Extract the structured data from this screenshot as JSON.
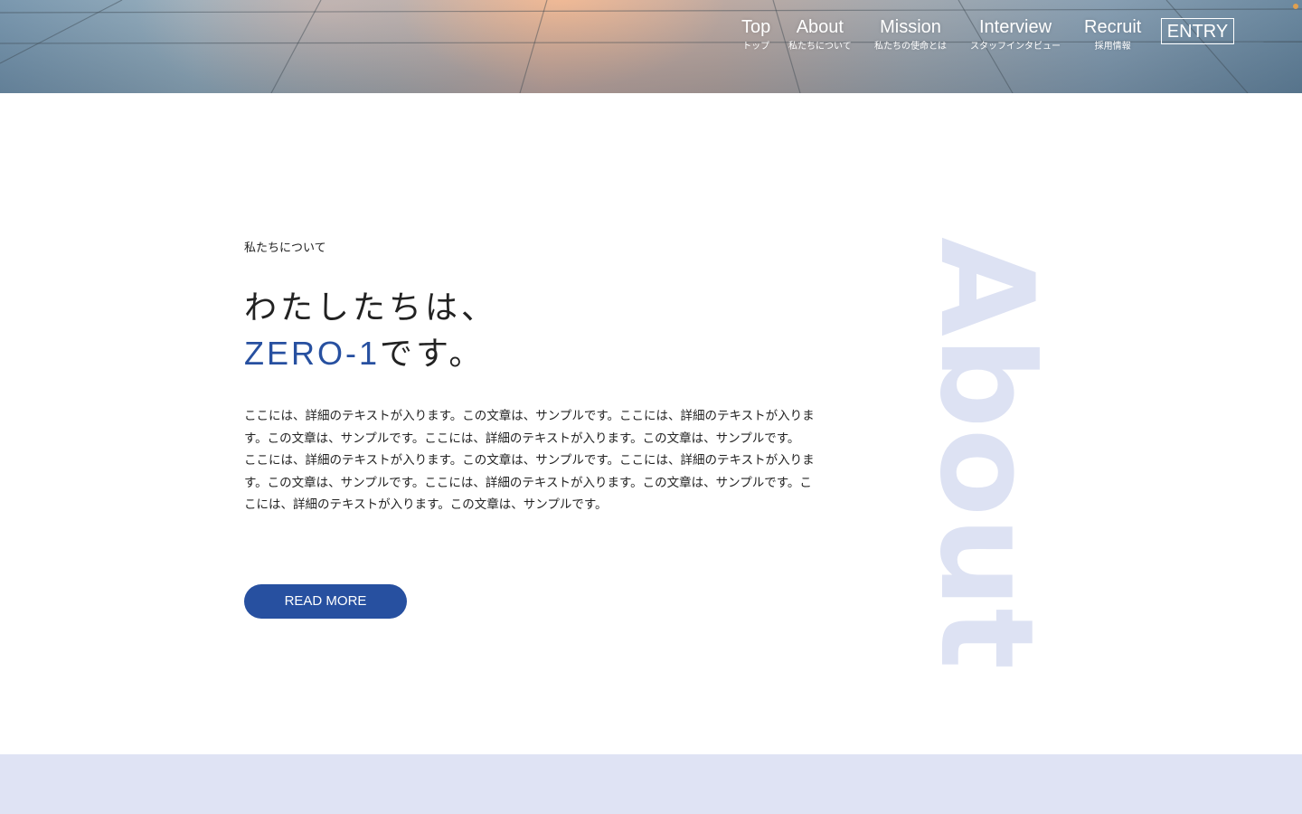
{
  "nav": {
    "items": [
      {
        "en": "Top",
        "ja": "トップ"
      },
      {
        "en": "About",
        "ja": "私たちについて"
      },
      {
        "en": "Mission",
        "ja": "私たちの使命とは"
      },
      {
        "en": "Interview",
        "ja": "スタッフインタビュー"
      },
      {
        "en": "Recruit",
        "ja": "採用情報"
      }
    ],
    "entry_label": "ENTRY"
  },
  "about": {
    "label": "私たちについて",
    "headline_line1": "わたしたちは、",
    "headline_brand": "ZERO-1",
    "headline_suffix": "です。",
    "paragraphs": [
      "ここには、詳細のテキストが入ります。この文章は、サンプルです。ここには、詳細のテキストが入ります。この文章は、サンプルです。ここには、詳細のテキストが入ります。この文章は、サンプルです。",
      "ここには、詳細のテキストが入ります。この文章は、サンプルです。ここには、詳細のテキストが入ります。この文章は、サンプルです。ここには、詳細のテキストが入ります。この文章は、サンプルです。ここには、詳細のテキストが入ります。この文章は、サンプルです。"
    ],
    "read_more_label": "READ MORE",
    "vertical_word": "About"
  },
  "colors": {
    "brand_blue": "#2750a0",
    "about_watermark": "#dde2f3",
    "band": "#dfe3f4"
  }
}
